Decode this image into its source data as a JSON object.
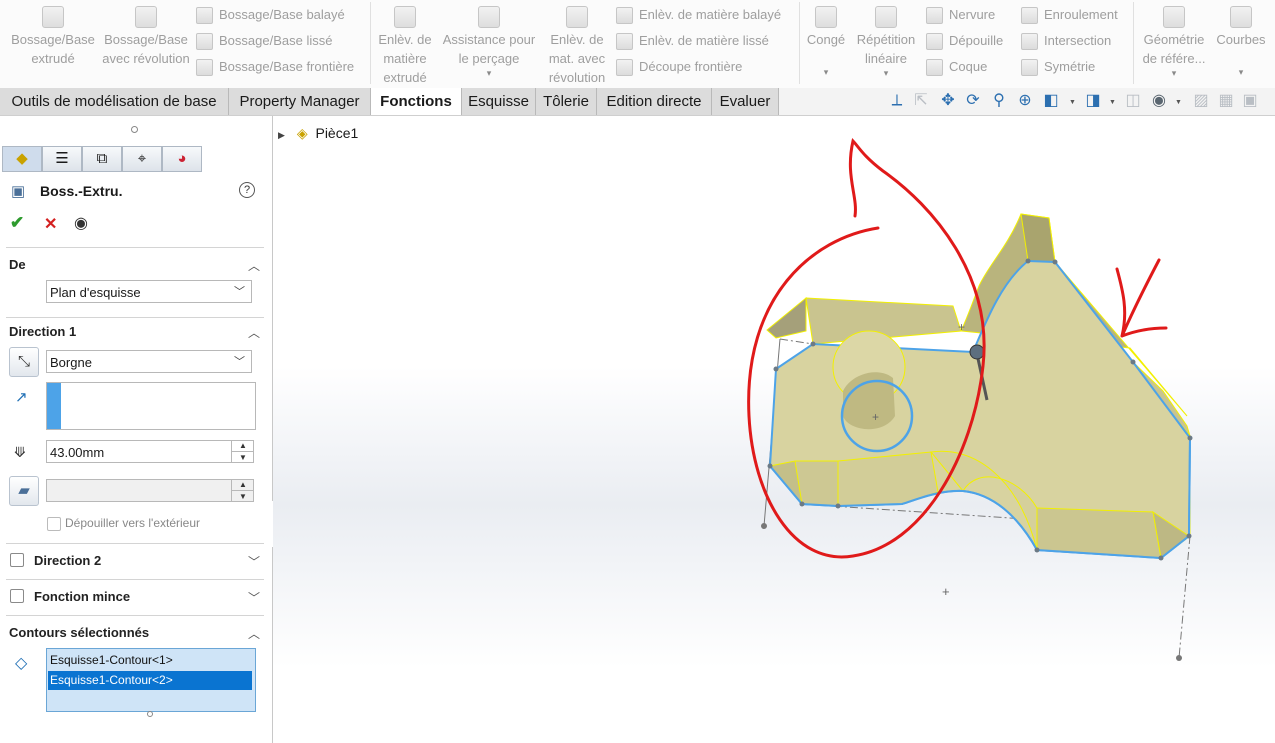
{
  "ribbon": {
    "big_buttons": [
      {
        "label": "Bossage/Base extrudé",
        "icon": "extruded-boss-icon"
      },
      {
        "label": "Bossage/Base avec révolution",
        "icon": "revolved-boss-icon"
      },
      {
        "label": "Enlèv. de matière extrudé",
        "icon": "extruded-cut-icon"
      },
      {
        "label": "Assistance pour le perçage",
        "icon": "hole-wizard-icon"
      },
      {
        "label": "Enlèv. de mat. avec révolution",
        "icon": "revolved-cut-icon"
      },
      {
        "label": "Congé",
        "icon": "fillet-icon"
      },
      {
        "label": "Répétition linéaire",
        "icon": "linear-pattern-icon"
      },
      {
        "label": "Géométrie de référe...",
        "icon": "reference-geometry-icon"
      },
      {
        "label": "Courbes",
        "icon": "curves-icon"
      }
    ],
    "small_buttons": [
      {
        "label": "Bossage/Base balayé",
        "icon": "swept-boss-icon"
      },
      {
        "label": "Bossage/Base lissé",
        "icon": "lofted-boss-icon"
      },
      {
        "label": "Bossage/Base frontière",
        "icon": "boundary-boss-icon"
      },
      {
        "label": "Enlèv. de matière balayé",
        "icon": "swept-cut-icon"
      },
      {
        "label": "Enlèv. de matière lissé",
        "icon": "lofted-cut-icon"
      },
      {
        "label": "Découpe frontière",
        "icon": "boundary-cut-icon"
      },
      {
        "label": "Nervure",
        "icon": "rib-icon"
      },
      {
        "label": "Dépouille",
        "icon": "draft-icon"
      },
      {
        "label": "Coque",
        "icon": "shell-icon"
      },
      {
        "label": "Enroulement",
        "icon": "wrap-icon"
      },
      {
        "label": "Intersection",
        "icon": "intersect-icon"
      },
      {
        "label": "Symétrie",
        "icon": "mirror-icon"
      }
    ]
  },
  "tabs": [
    {
      "label": "Outils de modélisation de base"
    },
    {
      "label": "Property Manager"
    },
    {
      "label": "Fonctions",
      "active": true
    },
    {
      "label": "Esquisse"
    },
    {
      "label": "Tôlerie"
    },
    {
      "label": "Edition directe"
    },
    {
      "label": "Evaluer"
    }
  ],
  "heads_up_toolbar": [
    "view-orientation-icon",
    "select-icon",
    "pan-icon",
    "rotate-icon",
    "zoom-icon",
    "zoom-fit-icon",
    "section-view-icon",
    "display-style-icon",
    "hide-show-icon",
    "appearance-icon",
    "scene-icon"
  ],
  "property_manager": {
    "feature_title": "Boss.-Extru.",
    "sections": {
      "from": {
        "title": "De",
        "start_condition": "Plan d'esquisse"
      },
      "direction1": {
        "title": "Direction 1",
        "end_condition": "Borgne",
        "depth": "43.00mm",
        "draft_outward_label": "Dépouiller vers l'extérieur",
        "draft_outward_checked": false
      },
      "direction2": {
        "title": "Direction 2",
        "checked": false
      },
      "thin_feature": {
        "title": "Fonction mince",
        "checked": false
      },
      "selected_contours": {
        "title": "Contours sélectionnés",
        "items": [
          {
            "label": "Esquisse1-Contour<1>",
            "selected": false
          },
          {
            "label": "Esquisse1-Contour<2>",
            "selected": true
          }
        ]
      }
    }
  },
  "feature_tree": {
    "root_label": "Pièce1"
  },
  "colors": {
    "body_face": "#d8d3a0",
    "selection_blue": "#4da3e8",
    "edge_yellow": "#f2f000",
    "annotation_red": "#e01a1a",
    "list_selected": "#0a74d1",
    "ok_green": "#2e9b2e",
    "cancel_red": "#d42020"
  }
}
